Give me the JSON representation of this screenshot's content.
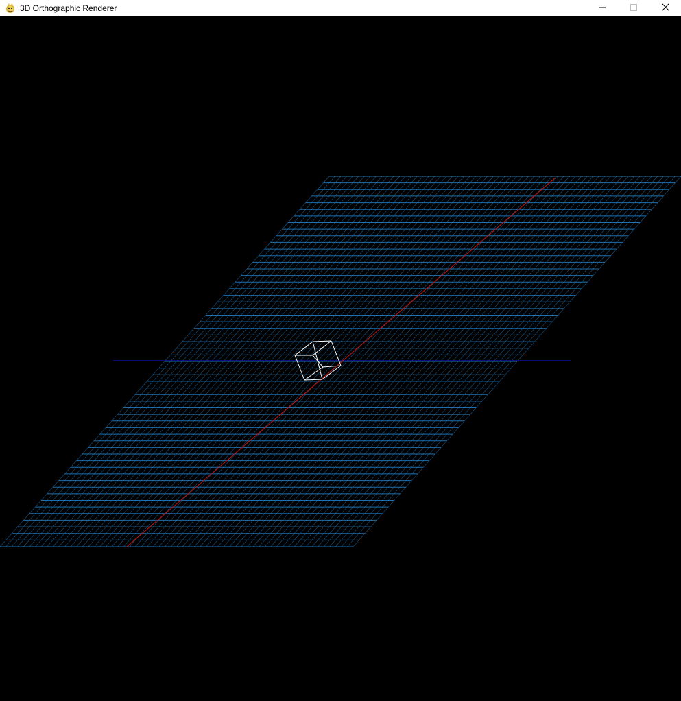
{
  "window": {
    "title": "3D Orthographic Renderer",
    "icon": "pygame-snake-icon",
    "controls": {
      "minimize_icon": "minimize-icon",
      "maximize_icon": "maximize-icon",
      "close_icon": "close-icon"
    }
  },
  "scene": {
    "background_color": "#000000",
    "grid_color": "#1f6fae",
    "x_axis_color": "#b01515",
    "z_axis_color": "#1010a0",
    "cube_color": "#ffffff"
  }
}
